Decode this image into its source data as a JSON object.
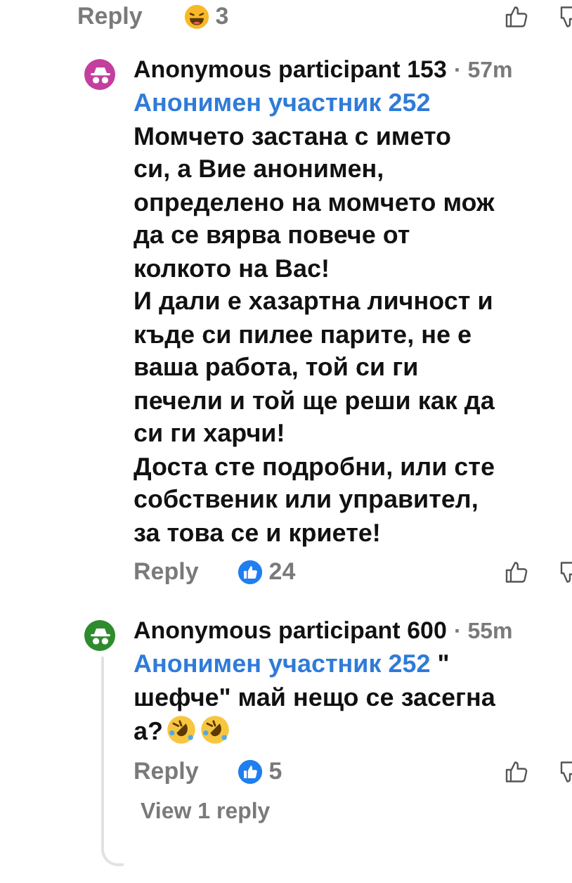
{
  "top_actions": {
    "reply": "Reply",
    "reaction": {
      "kind": "haha",
      "count": "3"
    }
  },
  "comments": [
    {
      "color": "#c23f9e",
      "author": "Anonymous participant 153",
      "time": "· 57m",
      "mention": "Анонимен участник 252",
      "body_lines": [
        "Момчето застана с  името",
        "си, а Вие анонимен,",
        "определено на момчето мож",
        "да се вярва повече от",
        "колкото на Вас!",
        "И дали е хазартна личност и",
        "къде си пилее парите, не е",
        "ваша работа, той си ги",
        "печели и той  ще реши как да",
        "си ги харчи!",
        "Доста сте подробни, или сте",
        "собственик или управител,",
        "за това се и криете!"
      ],
      "reply": "Reply",
      "reaction": {
        "kind": "like",
        "count": "24"
      }
    },
    {
      "color": "#2e8b2e",
      "author": "Anonymous participant 600",
      "time": "· 55m",
      "mention": "Анонимен участник 252",
      "mention_suffix": " \"",
      "body_lines": [
        "шефче\" май нещо се засегна",
        "а?"
      ],
      "trailing_emojis": [
        {
          "kind": "rofl"
        },
        {
          "kind": "rofl"
        }
      ],
      "reply": "Reply",
      "reaction": {
        "kind": "like",
        "count": "5"
      },
      "view_replies": "View 1 reply"
    }
  ]
}
